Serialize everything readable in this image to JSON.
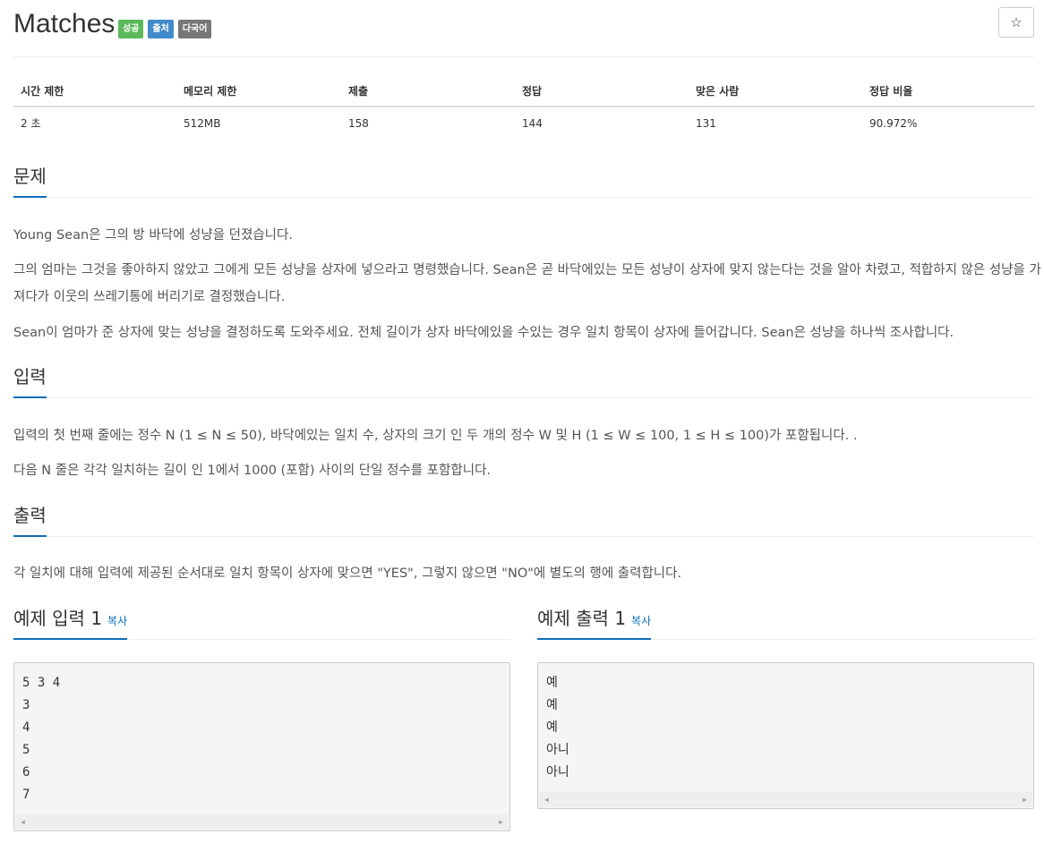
{
  "problem": {
    "title": "Matches",
    "badges": [
      {
        "label": "성공",
        "color": "#5cb85c"
      },
      {
        "label": "출처",
        "color": "#428bca"
      },
      {
        "label": "다국어",
        "color": "#777777"
      }
    ],
    "star_label": "☆"
  },
  "stats": {
    "headers": [
      "시간 제한",
      "메모리 제한",
      "제출",
      "정답",
      "맞은 사람",
      "정답 비율"
    ],
    "values": [
      "2 초",
      "512MB",
      "158",
      "144",
      "131",
      "90.972%"
    ]
  },
  "sections": {
    "problem": {
      "heading": "문제",
      "paragraphs": [
        "Young Sean은 그의 방 바닥에 성냥을 던졌습니다.",
        "그의 엄마는 그것을 좋아하지 않았고 그에게 모든 성냥을 상자에 넣으라고 명령했습니다. Sean은 곧 바닥에있는 모든 성냥이 상자에 맞지 않는다는 것을 알아 차렸고, 적합하지 않은 성냥을 가져다가 이웃의 쓰레기통에 버리기로 결정했습니다.",
        "Sean이 엄마가 준 상자에 맞는 성냥을 결정하도록 도와주세요. 전체 길이가 상자 바닥에있을 수있는 경우 일치 항목이 상자에 들어갑니다. Sean은 성냥을 하나씩 조사합니다."
      ]
    },
    "input": {
      "heading": "입력",
      "paragraphs": [
        "입력의 첫 번째 줄에는 정수 N (1 ≤ N ≤ 50), 바닥에있는 일치 수, 상자의 크기 인 두 개의 정수 W 및 H (1 ≤ W ≤ 100, 1 ≤ H ≤ 100)가 포함됩니다. .",
        "다음 N 줄은 각각 일치하는 길이 인 1에서 1000 (포함) 사이의 단일 정수를 포함합니다."
      ]
    },
    "output": {
      "heading": "출력",
      "paragraphs": [
        "각 일치에 대해 입력에 제공된 순서대로 일치 항목이 상자에 맞으면 \"YES\", 그렇지 않으면 \"NO\"에 별도의 행에 출력합니다."
      ]
    }
  },
  "samples": {
    "input": {
      "heading": "예제 입력 1",
      "copy": "복사",
      "lines": [
        "5 3 4",
        "3",
        "4",
        "5",
        "6",
        "7"
      ]
    },
    "output": {
      "heading": "예제 출력 1",
      "copy": "복사",
      "lines": [
        "예",
        "예",
        "예",
        "아니",
        "아니"
      ]
    }
  }
}
